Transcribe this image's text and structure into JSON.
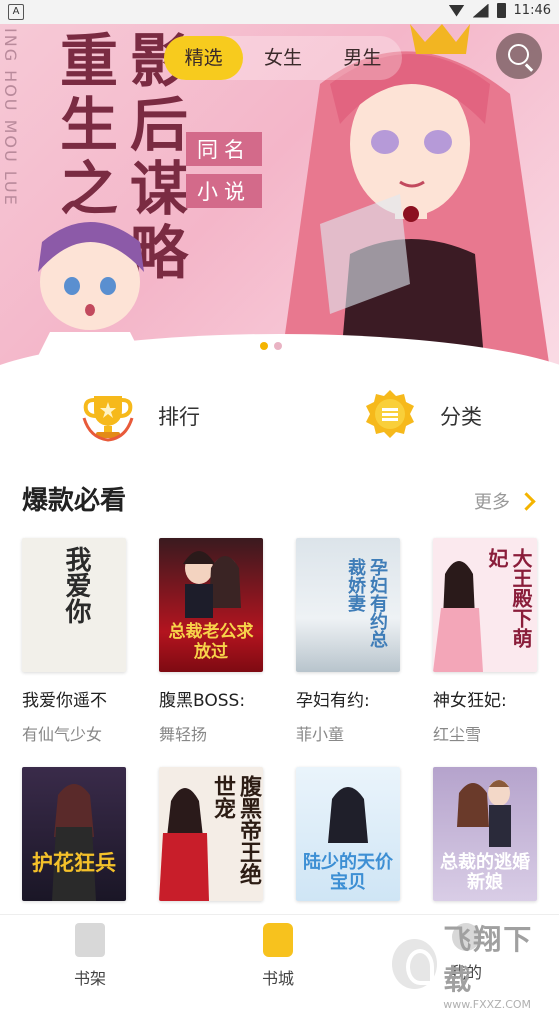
{
  "status_bar": {
    "time": "11:46",
    "left_icon": "A"
  },
  "banner": {
    "vertical_text": "ING HOU MOU LUE",
    "title_line1": "重生之",
    "title_line2": "影后谋略",
    "subtitle_line1": "同名",
    "subtitle_line2": "小说",
    "dots": 2,
    "active_dot": 0
  },
  "tabs": [
    {
      "label": "精选",
      "active": true
    },
    {
      "label": "女生",
      "active": false
    },
    {
      "label": "男生",
      "active": false
    }
  ],
  "quick_links": {
    "ranking": "排行",
    "category": "分类"
  },
  "section": {
    "title": "爆款必看",
    "more_label": "更多"
  },
  "books_row1": [
    {
      "title": "我爱你遥不",
      "author": "有仙气少女",
      "cover_text": "我爱你",
      "cover_bg": "#f2f0ea",
      "cover_fg": "#2a2a2a"
    },
    {
      "title": "腹黑BOSS:",
      "author": "舞轻扬",
      "cover_text": "总裁老公求放过",
      "cover_bg": "#b3141f",
      "cover_fg": "#f7d34a"
    },
    {
      "title": "孕妇有约:",
      "author": "菲小童",
      "cover_text": "孕妇有约总裁娇妻",
      "cover_bg": "#e4ebf0",
      "cover_fg": "#3f7db8"
    },
    {
      "title": "神女狂妃:",
      "author": "红尘雪",
      "cover_text": "大王殿下萌妃",
      "cover_bg": "#fbe9ee",
      "cover_fg": "#8a1d3a"
    }
  ],
  "books_row2": [
    {
      "cover_text": "护花狂兵",
      "cover_bg": "#1a1626",
      "cover_fg": "#f4c12a"
    },
    {
      "cover_text": "腹黑帝王绝世宠",
      "cover_bg": "#f4ede6",
      "cover_fg": "#2c1c14"
    },
    {
      "cover_text": "陆少的天价宝贝",
      "cover_bg": "#dfeefa",
      "cover_fg": "#3d8fd4"
    },
    {
      "cover_text": "总裁的逃婚新娘",
      "cover_bg": "#c9b9d8",
      "cover_fg": "#ffffff"
    }
  ],
  "nav": [
    {
      "label": "书架",
      "icon": "bookshelf-icon",
      "active": false
    },
    {
      "label": "书城",
      "icon": "bookstore-icon",
      "active": true
    },
    {
      "label": "我的",
      "icon": "profile-icon",
      "active": false
    }
  ],
  "watermark": {
    "main": "飞翔下载",
    "url": "www.FXXZ.COM"
  },
  "colors": {
    "accent": "#f7cb1e",
    "banner_title": "#7a2b42",
    "banner_badge": "#d36a8a"
  }
}
